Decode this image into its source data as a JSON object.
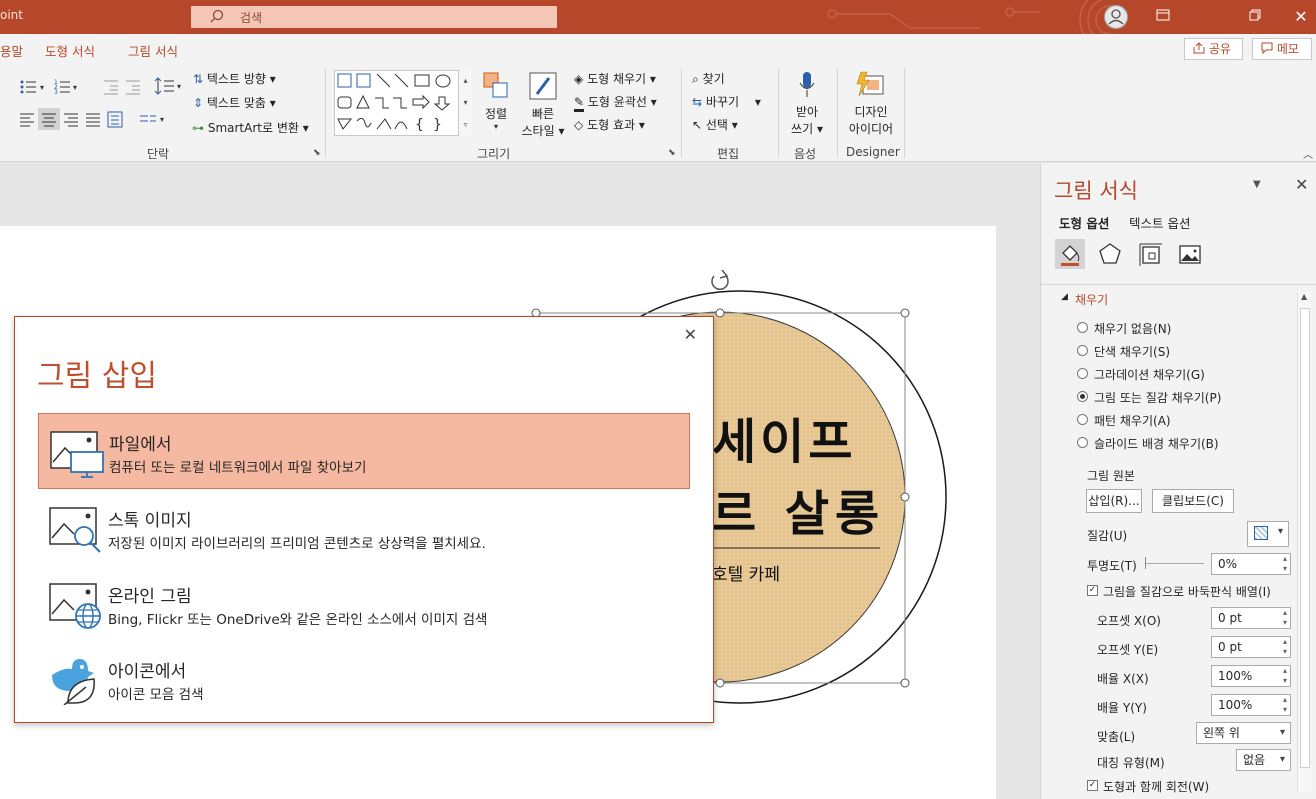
{
  "titlebar": {
    "app_name": "oint",
    "search_placeholder": "검색"
  },
  "tabs": [
    "용말",
    "도형 서식",
    "그림 서식"
  ],
  "header_actions": {
    "share": "공유",
    "memo": "메모"
  },
  "ribbon": {
    "paragraph": {
      "label": "단락",
      "text_direction": "텍스트 방향",
      "text_align": "텍스트 맞춤",
      "smartart": "SmartArt로 변환"
    },
    "drawing": {
      "label": "그리기",
      "arrange": "정렬",
      "quick_styles_1": "빠른",
      "quick_styles_2": "스타일",
      "shape_fill": "도형 채우기",
      "shape_outline": "도형 윤곽선",
      "shape_effects": "도형 효과"
    },
    "editing": {
      "label": "편집",
      "find": "찾기",
      "replace": "바꾸기",
      "select": "선택"
    },
    "voice": {
      "label": "음성",
      "dictate_1": "받아",
      "dictate_2": "쓰기"
    },
    "designer": {
      "label": "Designer",
      "ideas_1": "디자인",
      "ideas_2": "아이디어"
    }
  },
  "slide": {
    "line1": "세이프",
    "line2": "르 살롱",
    "subtitle": "호텔 카페"
  },
  "dialog": {
    "title": "그림 삽입",
    "options": [
      {
        "title": "파일에서",
        "desc": "컴퓨터 또는 로컬 네트워크에서 파일 찾아보기"
      },
      {
        "title": "스톡 이미지",
        "desc": "저장된 이미지 라이브러리의 프리미엄 콘텐츠로 상상력을 펼치세요."
      },
      {
        "title": "온라인 그림",
        "desc": "Bing, Flickr 또는 OneDrive와 같은 온라인 소스에서 이미지 검색"
      },
      {
        "title": "아이콘에서",
        "desc": "아이콘 모음 검색"
      }
    ]
  },
  "pane": {
    "title": "그림 서식",
    "tab_shape": "도형 옵션",
    "tab_text": "텍스트 옵션",
    "section": "채우기",
    "fill_options": [
      "채우기 없음(N)",
      "단색 채우기(S)",
      "그라데이션 채우기(G)",
      "그림 또는 질감 채우기(P)",
      "패턴 채우기(A)",
      "슬라이드 배경 채우기(B)"
    ],
    "picture_source": "그림 원본",
    "insert_btn": "삽입(R)...",
    "clipboard_btn": "클립보드(C)",
    "texture": "질감(U)",
    "transparency": "투명도(T)",
    "transparency_value": "0%",
    "tile_checkbox": "그림을 질감으로 바둑판식 배열(I)",
    "offset_x": "오프셋 X(O)",
    "offset_x_value": "0 pt",
    "offset_y": "오프셋 Y(E)",
    "offset_y_value": "0 pt",
    "scale_x": "배율 X(X)",
    "scale_x_value": "100%",
    "scale_y": "배율 Y(Y)",
    "scale_y_value": "100%",
    "alignment": "맞춤(L)",
    "alignment_value": "왼쪽 위",
    "mirror": "대칭 유형(M)",
    "mirror_value": "없음",
    "rotate_checkbox": "도형과 함께 회전(W)"
  }
}
